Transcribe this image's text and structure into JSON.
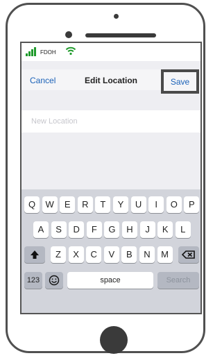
{
  "status_bar": {
    "carrier": "FDOH",
    "signal_icon": "signal-bars-icon",
    "wifi_icon": "wifi-icon"
  },
  "nav": {
    "cancel_label": "Cancel",
    "title": "Edit Location",
    "save_label": "Save"
  },
  "location_input": {
    "value": "",
    "placeholder": "New Location"
  },
  "keyboard": {
    "row1": [
      "Q",
      "W",
      "E",
      "R",
      "T",
      "Y",
      "U",
      "I",
      "O",
      "P"
    ],
    "row2": [
      "A",
      "S",
      "D",
      "F",
      "G",
      "H",
      "J",
      "K",
      "L"
    ],
    "row3": [
      "Z",
      "X",
      "C",
      "V",
      "B",
      "N",
      "M"
    ],
    "shift_icon": "shift-arrow-icon",
    "backspace_icon": "backspace-icon",
    "numbers_label": "123",
    "emoji_icon": "emoji-icon",
    "space_label": "space",
    "search_label": "Search"
  },
  "colors": {
    "link_blue": "#1b62b8",
    "signal_green": "#1f9a2b",
    "keyboard_background": "#d2d4db",
    "screen_background": "#eeeef2"
  }
}
